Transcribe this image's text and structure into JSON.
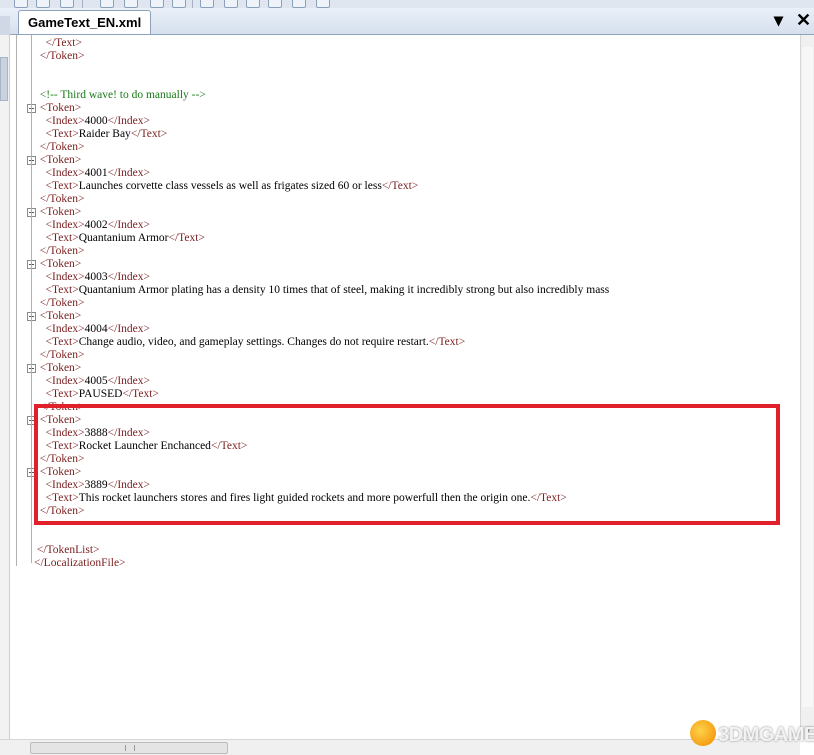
{
  "tab": {
    "title": "GameText_EN.xml"
  },
  "window_controls": {
    "dropdown_glyph": "▾",
    "close_glyph": "✕"
  },
  "code_lines": [
    [
      "",
      "    ",
      "tag:</Text>"
    ],
    [
      "",
      "  ",
      "tag:</Token>"
    ],
    [
      "",
      ""
    ],
    [
      "",
      ""
    ],
    [
      "",
      "  ",
      "cmt:<!-- Third wave! to do manually -->"
    ],
    [
      "fold",
      "  ",
      "tag:<Token>"
    ],
    [
      "",
      "    ",
      "tag:<Index>",
      "txt:4000",
      "tag:</Index>"
    ],
    [
      "",
      "    ",
      "tag:<Text>",
      "txt:Raider Bay",
      "tag:</Text>"
    ],
    [
      "",
      "  ",
      "tag:</Token>"
    ],
    [
      "fold",
      "  ",
      "tag:<Token>"
    ],
    [
      "",
      "    ",
      "tag:<Index>",
      "txt:4001",
      "tag:</Index>"
    ],
    [
      "",
      "    ",
      "tag:<Text>",
      "txt:Launches corvette class vessels as well as frigates sized 60 or less",
      "tag:</Text>"
    ],
    [
      "",
      "  ",
      "tag:</Token>"
    ],
    [
      "fold",
      "  ",
      "tag:<Token>"
    ],
    [
      "",
      "    ",
      "tag:<Index>",
      "txt:4002",
      "tag:</Index>"
    ],
    [
      "",
      "    ",
      "tag:<Text>",
      "txt:Quantanium Armor",
      "tag:</Text>"
    ],
    [
      "",
      "  ",
      "tag:</Token>"
    ],
    [
      "fold",
      "  ",
      "tag:<Token>"
    ],
    [
      "",
      "    ",
      "tag:<Index>",
      "txt:4003",
      "tag:</Index>"
    ],
    [
      "",
      "    ",
      "tag:<Text>",
      "txt:Quantanium Armor plating has a density 10 times that of steel, making it incredibly strong but also incredibly mass"
    ],
    [
      "",
      "  ",
      "tag:</Token>"
    ],
    [
      "fold",
      "  ",
      "tag:<Token>"
    ],
    [
      "",
      "    ",
      "tag:<Index>",
      "txt:4004",
      "tag:</Index>"
    ],
    [
      "",
      "    ",
      "tag:<Text>",
      "txt:Change audio, video, and gameplay settings. Changes do not require restart.",
      "tag:</Text>"
    ],
    [
      "",
      "  ",
      "tag:</Token>"
    ],
    [
      "fold",
      "  ",
      "tag:<Token>"
    ],
    [
      "",
      "    ",
      "tag:<Index>",
      "txt:4005",
      "tag:</Index>"
    ],
    [
      "",
      "    ",
      "tag:<Text>",
      "txt:PAUSED",
      "tag:</Text>"
    ],
    [
      "",
      "  ",
      "tag:</Token>"
    ],
    [
      "fold",
      "  ",
      "tag:<Token>"
    ],
    [
      "",
      "    ",
      "tag:<Index>",
      "txt:3888",
      "tag:</Index>"
    ],
    [
      "",
      "    ",
      "tag:<Text>",
      "txt:Rocket Launcher Enchanced",
      "tag:</Text>"
    ],
    [
      "",
      "  ",
      "tag:</Token>"
    ],
    [
      "fold",
      "  ",
      "tag:<Token>"
    ],
    [
      "",
      "    ",
      "tag:<Index>",
      "txt:3889",
      "tag:</Index>"
    ],
    [
      "",
      "    ",
      "tag:<Text>",
      "txt:This rocket launchers stores and fires light guided rockets and more powerfull then the origin one.",
      "tag:</Text>"
    ],
    [
      "",
      "  ",
      "tag:</Token>"
    ],
    [
      "",
      ""
    ],
    [
      "",
      ""
    ],
    [
      "",
      " ",
      "tag:</TokenList>"
    ],
    [
      "",
      "",
      "tag:</LocalizationFile>"
    ]
  ],
  "highlight": {
    "color": "#e0202a",
    "covers_tokens": [
      "3888",
      "3889"
    ]
  },
  "colors": {
    "tag": "#7a1e1e",
    "comment": "#1a7a1a",
    "text": "#000000"
  },
  "watermark": {
    "text": "3DMGAME",
    "logo": "3dm-mascot-icon"
  }
}
